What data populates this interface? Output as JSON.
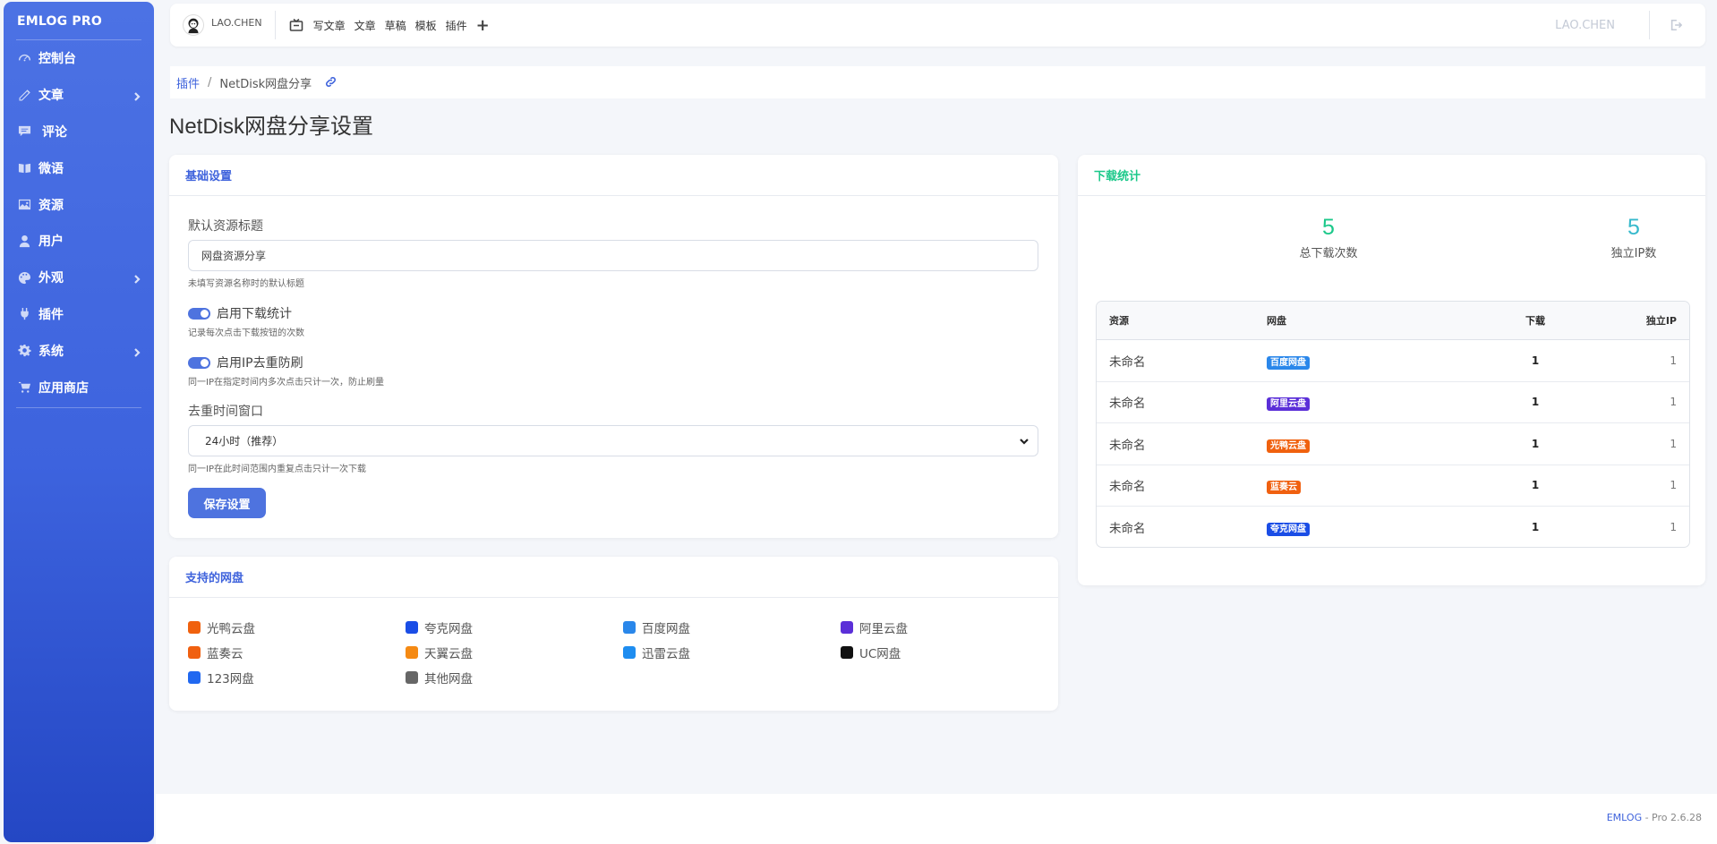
{
  "sidebar": {
    "brand": "EMLOG PRO",
    "items": [
      {
        "label": "控制台",
        "icon": "dashboard-gauge-icon",
        "has_children": false
      },
      {
        "label": "文章",
        "icon": "pencil-icon",
        "has_children": true
      },
      {
        "label": "评论",
        "icon": "comment-icon",
        "has_children": false
      },
      {
        "label": "微语",
        "icon": "micro-post-icon",
        "has_children": false
      },
      {
        "label": "资源",
        "icon": "image-icon",
        "has_children": false
      },
      {
        "label": "用户",
        "icon": "user-icon",
        "has_children": false
      },
      {
        "label": "外观",
        "icon": "palette-icon",
        "has_children": true
      },
      {
        "label": "插件",
        "icon": "plug-icon",
        "has_children": false
      },
      {
        "label": "系统",
        "icon": "gear-icon",
        "has_children": true
      },
      {
        "label": "应用商店",
        "icon": "cart-icon",
        "has_children": false
      }
    ]
  },
  "topbar": {
    "username": "LAO.CHEN",
    "links": [
      "写文章",
      "文章",
      "草稿",
      "模板",
      "插件"
    ],
    "plus": "+",
    "right_username": "LAO.CHEN"
  },
  "breadcrumb": {
    "parent": "插件",
    "separator": "/",
    "current": "NetDisk网盘分享"
  },
  "page": {
    "title": "NetDisk网盘分享设置"
  },
  "settings": {
    "header": "基础设置",
    "default_title_label": "默认资源标题",
    "default_title_value": "网盘资源分享",
    "default_title_help": "未填写资源名称时的默认标题",
    "enable_stats_label": "启用下载统计",
    "enable_stats_on": true,
    "enable_stats_help": "记录每次点击下载按钮的次数",
    "enable_dedupe_label": "启用IP去重防刷",
    "enable_dedupe_on": true,
    "enable_dedupe_help": "同一IP在指定时间内多次点击只计一次，防止刷量",
    "window_label": "去重时间窗口",
    "window_value": "24小时（推荐）",
    "window_help": "同一IP在此时间范围内重复点击只计一次下载",
    "save_button": "保存设置"
  },
  "supported": {
    "header": "支持的网盘",
    "items": [
      {
        "name": "光鸭云盘",
        "color": "#f0610e"
      },
      {
        "name": "夸克网盘",
        "color": "#1a4de6"
      },
      {
        "name": "百度网盘",
        "color": "#2a87ea"
      },
      {
        "name": "阿里云盘",
        "color": "#5b2fd8"
      },
      {
        "name": "蓝奏云",
        "color": "#f06010"
      },
      {
        "name": "天翼云盘",
        "color": "#f58a13"
      },
      {
        "name": "迅雷云盘",
        "color": "#1e8df0"
      },
      {
        "name": "UC网盘",
        "color": "#111111"
      },
      {
        "name": "123网盘",
        "color": "#2168f0"
      },
      {
        "name": "其他网盘",
        "color": "#666666"
      }
    ]
  },
  "stats": {
    "header": "下载统计",
    "total_downloads": "5",
    "total_downloads_label": "总下载次数",
    "unique_ip": "5",
    "unique_ip_label": "独立IP数",
    "total_color": "#1cc88a",
    "unique_color": "#36b9cc",
    "columns": [
      "资源",
      "网盘",
      "下载",
      "独立IP"
    ],
    "rows": [
      {
        "resource": "未命名",
        "disk": "百度网盘",
        "disk_color": "#2a87ea",
        "downloads": "1",
        "unique_ip": "1"
      },
      {
        "resource": "未命名",
        "disk": "阿里云盘",
        "disk_color": "#5b2fd8",
        "downloads": "1",
        "unique_ip": "1"
      },
      {
        "resource": "未命名",
        "disk": "光鸭云盘",
        "disk_color": "#f0610e",
        "downloads": "1",
        "unique_ip": "1"
      },
      {
        "resource": "未命名",
        "disk": "蓝奏云",
        "disk_color": "#f06010",
        "downloads": "1",
        "unique_ip": "1"
      },
      {
        "resource": "未命名",
        "disk": "夸克网盘",
        "disk_color": "#1a4de6",
        "downloads": "1",
        "unique_ip": "1"
      }
    ]
  },
  "footer": {
    "brand": "EMLOG",
    "version": " - Pro 2.6.28"
  },
  "colors": {
    "primary": "#4e73df",
    "sidebar_top": "#4c72e4",
    "sidebar_bottom": "#2447c4"
  }
}
